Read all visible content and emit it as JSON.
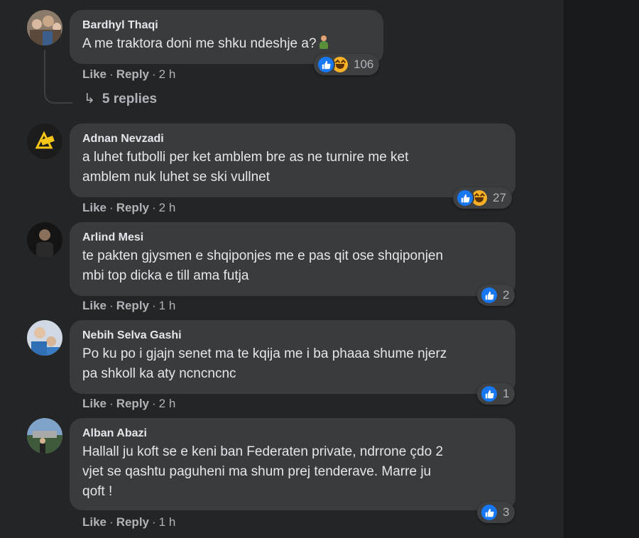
{
  "colors": {
    "panel_bg": "#242526",
    "bubble_bg": "#3a3b3c",
    "text_primary": "#e4e6eb",
    "text_secondary": "#b0b3b8",
    "like_blue": "#1877f2",
    "haha_yellow": "#f7b125"
  },
  "actions": {
    "like": "Like",
    "reply": "Reply",
    "separator": "·"
  },
  "comments": [
    {
      "author": "Bardhyl Thaqi",
      "lines": [
        "A me traktora doni me shku ndeshje a?"
      ],
      "emoji": "person-gesturing-icon",
      "time": "2 h",
      "reactions": [
        "like-icon",
        "haha-icon"
      ],
      "reaction_count": "106",
      "replies_label": "5 replies"
    },
    {
      "author": "Adnan Nevzadi",
      "lines": [
        "a luhet futbolli per ket amblem bre as ne turnire me ket",
        "amblem nuk luhet se ski vullnet"
      ],
      "time": "2 h",
      "reactions": [
        "like-icon",
        "haha-icon"
      ],
      "reaction_count": "27"
    },
    {
      "author": "Arlind Mesi",
      "lines": [
        "te pakten gjysmen e shqiponjes me e pas qit ose shqiponjen",
        "mbi top dicka e till ama futja"
      ],
      "time": "1 h",
      "reactions": [
        "like-icon"
      ],
      "reaction_count": "2"
    },
    {
      "author": "Nebih Selva Gashi",
      "lines": [
        "Po ku po i gjajn senet ma te kqija me i ba phaaa shume njerz",
        "pa shkoll ka aty ncncncnc"
      ],
      "time": "2 h",
      "reactions": [
        "like-icon"
      ],
      "reaction_count": "1"
    },
    {
      "author": "Alban Abazi",
      "lines": [
        "Hallall ju koft se e keni ban Federaten private, ndrrone çdo 2",
        "vjet se qashtu paguheni ma shum prej tenderave. Marre ju",
        "qoft !"
      ],
      "time": "1 h",
      "reactions": [
        "like-icon"
      ],
      "reaction_count": "3"
    }
  ]
}
